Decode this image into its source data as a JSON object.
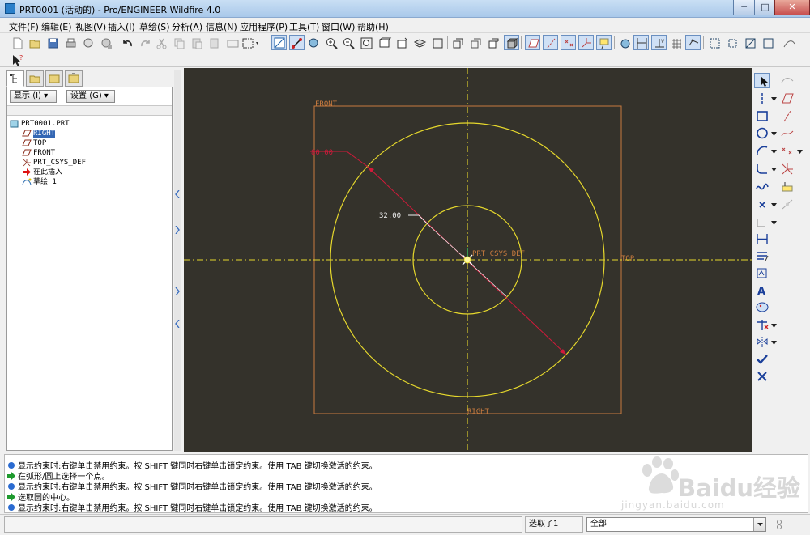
{
  "window": {
    "title": "PRT0001 (活动的) - Pro/ENGINEER Wildfire 4.0",
    "controls": {
      "minimize": "─",
      "maximize": "□",
      "close": "✕"
    }
  },
  "menu": [
    "文件(F)",
    "编辑(E)",
    "视图(V)",
    "插入(I)",
    "草绘(S)",
    "分析(A)",
    "信息(N)",
    "应用程序(P)",
    "工具(T)",
    "窗口(W)",
    "帮助(H)"
  ],
  "toolbar": {
    "icons": [
      "new-file-icon",
      "open-file-icon",
      "save-icon",
      "print-icon",
      "email-icon",
      "undo-icon",
      "redo-icon",
      "cut-icon",
      "copy-icon",
      "paste-icon",
      "regenerate-icon",
      "select-box-icon",
      "zoom-in-icon",
      "zoom-out-icon",
      "refit-icon",
      "saved-views-icon",
      "layers-icon",
      "datum-plane-icon",
      "datum-axis-icon",
      "datum-point-icon",
      "csys-icon"
    ]
  },
  "navigator": {
    "show_button": "显示",
    "show_button_key": "(I)",
    "settings_button": "设置",
    "settings_button_key": "(G)",
    "tree": [
      {
        "label": "PRT0001.PRT",
        "icon": "part-icon",
        "indent": 0,
        "selected": false
      },
      {
        "label": "RIGHT",
        "icon": "datum-plane-icon",
        "indent": 1,
        "selected": true
      },
      {
        "label": "TOP",
        "icon": "datum-plane-icon",
        "indent": 1,
        "selected": false
      },
      {
        "label": "FRONT",
        "icon": "datum-plane-icon",
        "indent": 1,
        "selected": false
      },
      {
        "label": "PRT_CSYS_DEF",
        "icon": "csys-icon",
        "indent": 1,
        "selected": false
      },
      {
        "label": "在此插入",
        "icon": "insert-arrow-icon",
        "indent": 1,
        "selected": false
      },
      {
        "label": "草绘 1",
        "icon": "sketch-icon",
        "indent": 1,
        "selected": false
      }
    ]
  },
  "graphics": {
    "background": "#34322b",
    "labels": {
      "front": "FRONT",
      "top": "TOP",
      "right": "RIGHT",
      "csys": "PRT_CSYS_DEF"
    },
    "dimensions": {
      "outer_diameter": "80.00",
      "inner_diameter": "32.00"
    },
    "colors": {
      "geometry": "#e6d82c",
      "datum": "#c97b3f",
      "dimension": "#d21a3a",
      "dim_text": "#f0f0f0"
    }
  },
  "sketch_tools": [
    "select-arrow-icon",
    "line-icon",
    "centerline-icon",
    "rectangle-icon",
    "circle-icon",
    "arc-icon",
    "fillet-icon",
    "spline-icon",
    "point-icon",
    "offset-edge-icon",
    "dimension-icon",
    "modify-icon",
    "constraints-icon",
    "text-icon",
    "palette-icon",
    "trim-icon",
    "mirror-icon",
    "done-checkmark-icon",
    "quit-x-icon",
    "construction-line-icon",
    "construction-point-icon",
    "delete-segment-icon",
    "thicken-icon",
    "sketch-diagnostic-icon"
  ],
  "messages": [
    {
      "icon": "info",
      "text": "显示约束时:右键单击禁用约束。按 SHIFT 键同时右键单击锁定约束。使用 TAB 键切换激活的约束。"
    },
    {
      "icon": "prompt",
      "text": "在弧形/圆上选择一个点。"
    },
    {
      "icon": "info",
      "text": "显示约束时:右键单击禁用约束。按 SHIFT 键同时右键单击锁定约束。使用 TAB 键切换激活的约束。"
    },
    {
      "icon": "prompt",
      "text": "选取圆的中心。"
    },
    {
      "icon": "info",
      "text": "显示约束时:右键单击禁用约束。按 SHIFT 键同时右键单击锁定约束。使用 TAB 键切换激活的约束。"
    }
  ],
  "status": {
    "selected": "选取了1",
    "filter": "全部"
  },
  "watermark": {
    "text": "Baidu经验",
    "url": "jingyan.baidu.com"
  }
}
